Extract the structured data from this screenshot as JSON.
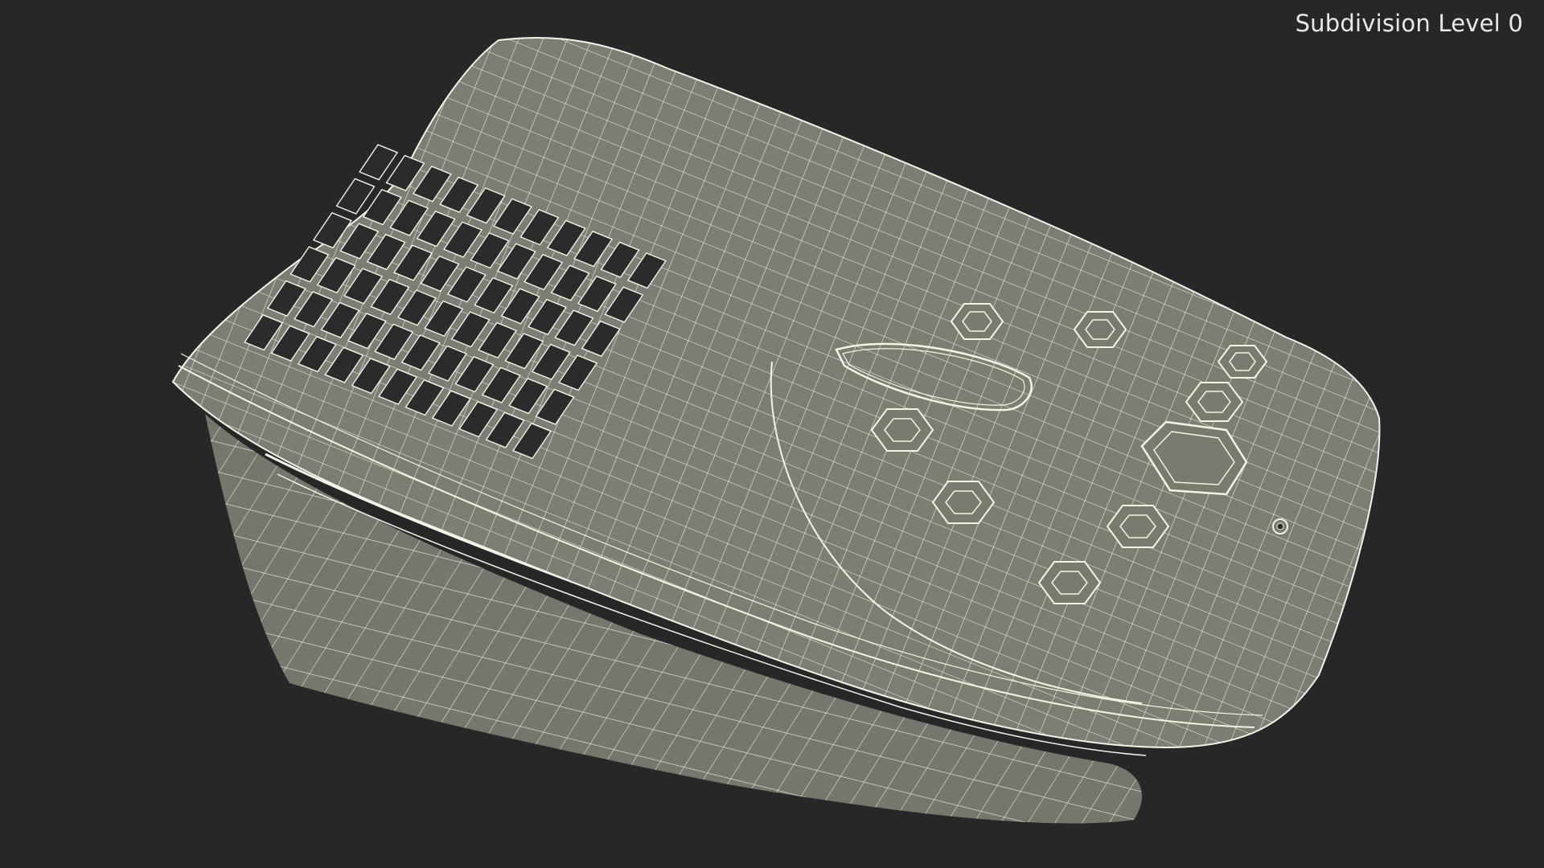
{
  "viewport": {
    "label": "Subdivision Level 0",
    "background_color": "#272727",
    "mesh_fill_color": "#7b7b72",
    "wire_color": "#f3f3e8"
  }
}
